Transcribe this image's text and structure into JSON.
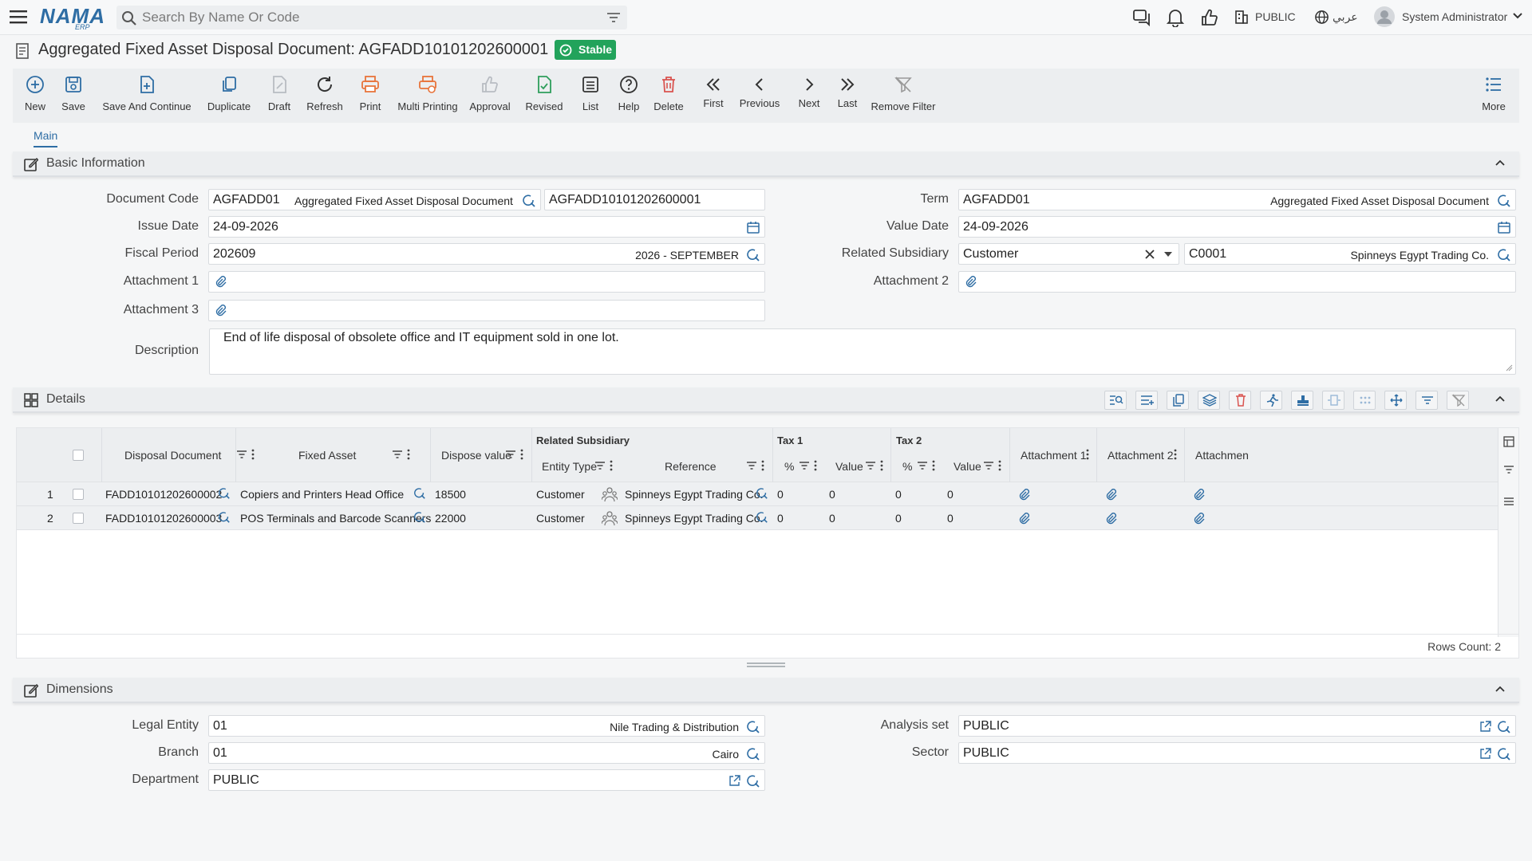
{
  "header": {
    "logo_text": "NAMA",
    "logo_sub": "ERP",
    "search_placeholder": "Search By Name Or Code",
    "analysis_set": "PUBLIC",
    "language": "عربي",
    "user": "System Administrator"
  },
  "page": {
    "title": "Aggregated Fixed Asset Disposal Document: AGFADD10101202600001",
    "status": "Stable"
  },
  "toolbar": {
    "new": "New",
    "save": "Save",
    "save_continue": "Save And Continue",
    "duplicate": "Duplicate",
    "draft": "Draft",
    "refresh": "Refresh",
    "print": "Print",
    "multi_printing": "Multi Printing",
    "approval": "Approval",
    "revised": "Revised",
    "list": "List",
    "help": "Help",
    "delete": "Delete",
    "first": "First",
    "previous": "Previous",
    "next": "Next",
    "last": "Last",
    "remove_filter": "Remove Filter",
    "more": "More"
  },
  "tabs": {
    "main": "Main"
  },
  "basic": {
    "title": "Basic Information",
    "document_code_label": "Document Code",
    "document_code": "AGFADD01",
    "document_code_name": "Aggregated Fixed Asset Disposal Document",
    "document_number": "AGFADD10101202600001",
    "term_label": "Term",
    "term": "AGFADD01",
    "term_name": "Aggregated Fixed Asset Disposal Document",
    "issue_date_label": "Issue Date",
    "issue_date": "24-09-2026",
    "value_date_label": "Value Date",
    "value_date": "24-09-2026",
    "fiscal_period_label": "Fiscal Period",
    "fiscal_period": "202609",
    "fiscal_period_name": "2026 - SEPTEMBER",
    "related_subsidiary_label": "Related Subsidiary",
    "related_subsidiary_type": "Customer",
    "related_subsidiary_code": "C0001",
    "related_subsidiary_name": "Spinneys Egypt Trading Co.",
    "attachment1_label": "Attachment 1",
    "attachment2_label": "Attachment 2",
    "attachment3_label": "Attachment 3",
    "description_label": "Description",
    "description": "End of life disposal of obsolete office and IT equipment sold in one lot."
  },
  "details": {
    "title": "Details",
    "columns": {
      "disposal_document": "Disposal Document",
      "fixed_asset": "Fixed Asset",
      "dispose_value": "Dispose value",
      "related_subsidiary": "Related Subsidiary",
      "entity_type": "Entity Type",
      "reference": "Reference",
      "tax1": "Tax 1",
      "tax2": "Tax 2",
      "percent": "%",
      "value": "Value",
      "attachment1": "Attachment 1",
      "attachment2": "Attachment 2",
      "attachment3": "Attachmen"
    },
    "rows": [
      {
        "num": "1",
        "disposal_document": "FADD10101202600002",
        "fixed_asset": "Copiers and Printers Head Office",
        "dispose_value": "18500",
        "entity_type": "Customer",
        "reference": "Spinneys Egypt Trading Co.",
        "tax1_pct": "0",
        "tax1_val": "0",
        "tax2_pct": "0",
        "tax2_val": "0"
      },
      {
        "num": "2",
        "disposal_document": "FADD10101202600003",
        "fixed_asset": "POS Terminals and Barcode Scanners",
        "dispose_value": "22000",
        "entity_type": "Customer",
        "reference": "Spinneys Egypt Trading Co.",
        "tax1_pct": "0",
        "tax1_val": "0",
        "tax2_pct": "0",
        "tax2_val": "0"
      }
    ],
    "rows_count": "Rows Count: 2"
  },
  "dimensions": {
    "title": "Dimensions",
    "legal_entity_label": "Legal Entity",
    "legal_entity": "01",
    "legal_entity_name": "Nile Trading & Distribution",
    "branch_label": "Branch",
    "branch": "01",
    "branch_name": "Cairo",
    "department_label": "Department",
    "department": "PUBLIC",
    "analysis_set_label": "Analysis set",
    "analysis_set": "PUBLIC",
    "sector_label": "Sector",
    "sector": "PUBLIC"
  },
  "colors": {
    "accent": "#2e6da4",
    "stable": "#22a35b",
    "danger": "#d9534f",
    "orange": "#e8743b",
    "green": "#2e9e5b"
  }
}
